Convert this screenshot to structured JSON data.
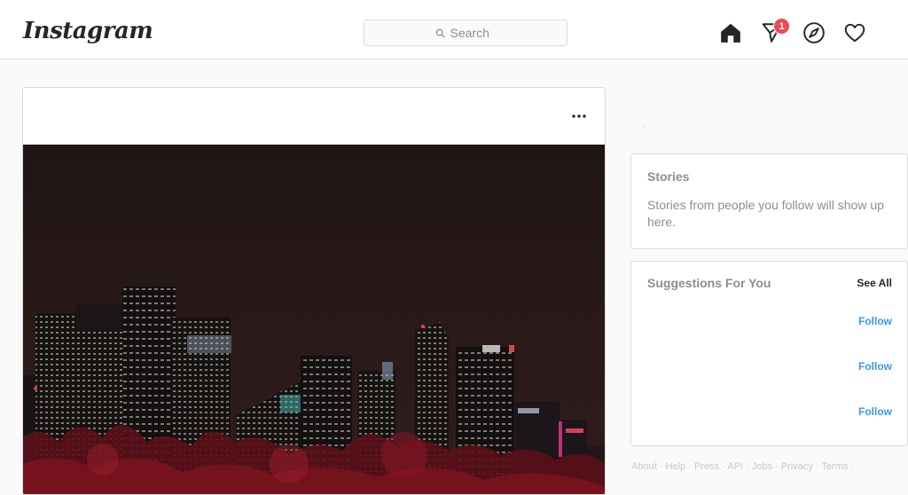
{
  "header": {
    "logo": "Instagram",
    "search_placeholder": "Search",
    "direct_badge_count": "1"
  },
  "post": {
    "more_icon": "ellipsis-icon",
    "image_description_icon": "city-skyline-photo"
  },
  "sidebar": {
    "faint_mark": "`",
    "stories": {
      "title": "Stories",
      "empty_text": "Stories from people you follow will show up here."
    },
    "suggestions": {
      "title": "Suggestions For You",
      "see_all": "See All",
      "follow_buttons": [
        "Follow",
        "Follow",
        "Follow"
      ]
    },
    "footer_links": [
      "About",
      "Help",
      "Press",
      "API",
      "Jobs",
      "Privacy",
      "Terms"
    ]
  },
  "colors": {
    "accent": "#3897f0",
    "badge": "#ed4956",
    "border": "#dbdbdb",
    "muted": "#8e8e8e"
  }
}
